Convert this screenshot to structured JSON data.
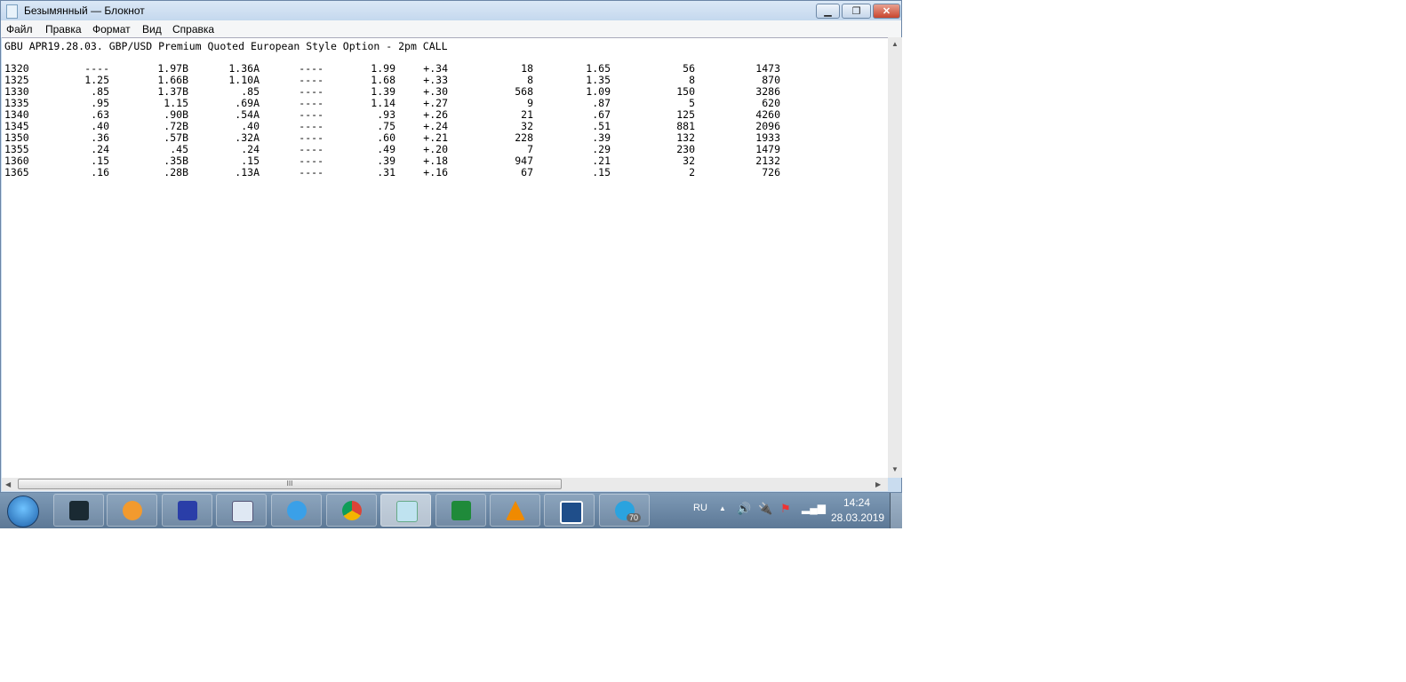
{
  "window": {
    "title": "Безымянный — Блокнот",
    "buttons": {
      "minimize": "▁",
      "maximize": "❐",
      "close": "✕"
    }
  },
  "menu": [
    "Файл",
    "Правка",
    "Формат",
    "Вид",
    "Справка"
  ],
  "document": {
    "heading": "GBU APR19.28.03. GBP/USD Premium Quoted European Style Option - 2pm CALL",
    "rows": [
      [
        "1320",
        "----",
        "1.97B",
        "1.36A",
        "----",
        "1.99",
        "+.34",
        "18",
        "1.65",
        "56",
        "1473"
      ],
      [
        "1325",
        "1.25",
        "1.66B",
        "1.10A",
        "----",
        "1.68",
        "+.33",
        "8",
        "1.35",
        "8",
        "870"
      ],
      [
        "1330",
        ".85",
        "1.37B",
        ".85",
        "----",
        "1.39",
        "+.30",
        "568",
        "1.09",
        "150",
        "3286"
      ],
      [
        "1335",
        ".95",
        "1.15",
        ".69A",
        "----",
        "1.14",
        "+.27",
        "9",
        ".87",
        "5",
        "620"
      ],
      [
        "1340",
        ".63",
        ".90B",
        ".54A",
        "----",
        ".93",
        "+.26",
        "21",
        ".67",
        "125",
        "4260"
      ],
      [
        "1345",
        ".40",
        ".72B",
        ".40",
        "----",
        ".75",
        "+.24",
        "32",
        ".51",
        "881",
        "2096"
      ],
      [
        "1350",
        ".36",
        ".57B",
        ".32A",
        "----",
        ".60",
        "+.21",
        "228",
        ".39",
        "132",
        "1933"
      ],
      [
        "1355",
        ".24",
        ".45",
        ".24",
        "----",
        ".49",
        "+.20",
        "7",
        ".29",
        "230",
        "1479"
      ],
      [
        "1360",
        ".15",
        ".35B",
        ".15",
        "----",
        ".39",
        "+.18",
        "947",
        ".21",
        "32",
        "2132"
      ],
      [
        "1365",
        ".16",
        ".28B",
        ".13A",
        "----",
        ".31",
        "+.16",
        "67",
        ".15",
        "2",
        "726"
      ]
    ]
  },
  "scrollbar": {
    "grip": "III"
  },
  "taskbar": {
    "apps": [
      "printer",
      "media-player",
      "save",
      "document-viewer",
      "internet-explorer",
      "chrome",
      "notepad",
      "excel",
      "aimp",
      "cryptopro",
      "telegram"
    ],
    "telegram_badge": "70",
    "tray": {
      "lang": "RU",
      "time": "14:24",
      "date": "28.03.2019"
    }
  }
}
